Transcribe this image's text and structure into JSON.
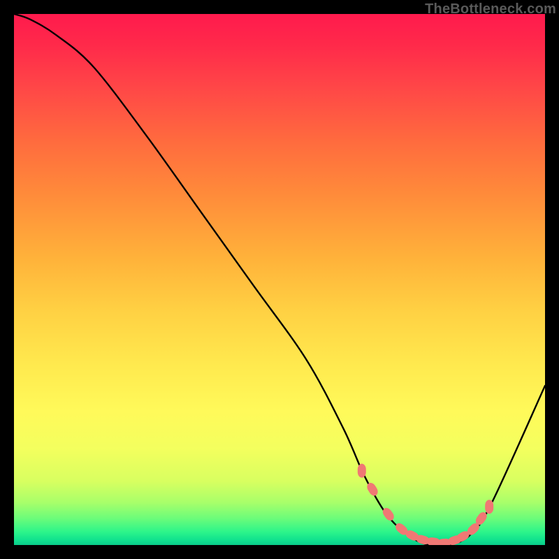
{
  "watermark": "TheBottleneck.com",
  "chart_data": {
    "type": "line",
    "title": "",
    "xlabel": "",
    "ylabel": "",
    "xlim": [
      0,
      100
    ],
    "ylim": [
      0,
      100
    ],
    "series": [
      {
        "name": "bottleneck-curve",
        "x": [
          0,
          3,
          8,
          15,
          25,
          35,
          45,
          55,
          62,
          66,
          70,
          74,
          78,
          82,
          86,
          90,
          100
        ],
        "values": [
          100,
          99,
          96,
          90,
          77,
          63,
          49,
          35,
          22,
          13,
          6,
          2,
          0,
          0,
          2,
          8,
          30
        ]
      }
    ],
    "markers": {
      "name": "sweet-spot-markers",
      "x": [
        65.5,
        67.5,
        70.5,
        73.0,
        75.0,
        77.0,
        79.0,
        81.0,
        83.0,
        84.5,
        86.5,
        88.0,
        89.5
      ],
      "values": [
        14.0,
        10.5,
        5.8,
        3.0,
        1.8,
        1.0,
        0.6,
        0.4,
        0.9,
        1.6,
        3.0,
        5.0,
        7.2
      ]
    },
    "colors": {
      "curve": "#000000",
      "marker": "#f07874"
    }
  }
}
